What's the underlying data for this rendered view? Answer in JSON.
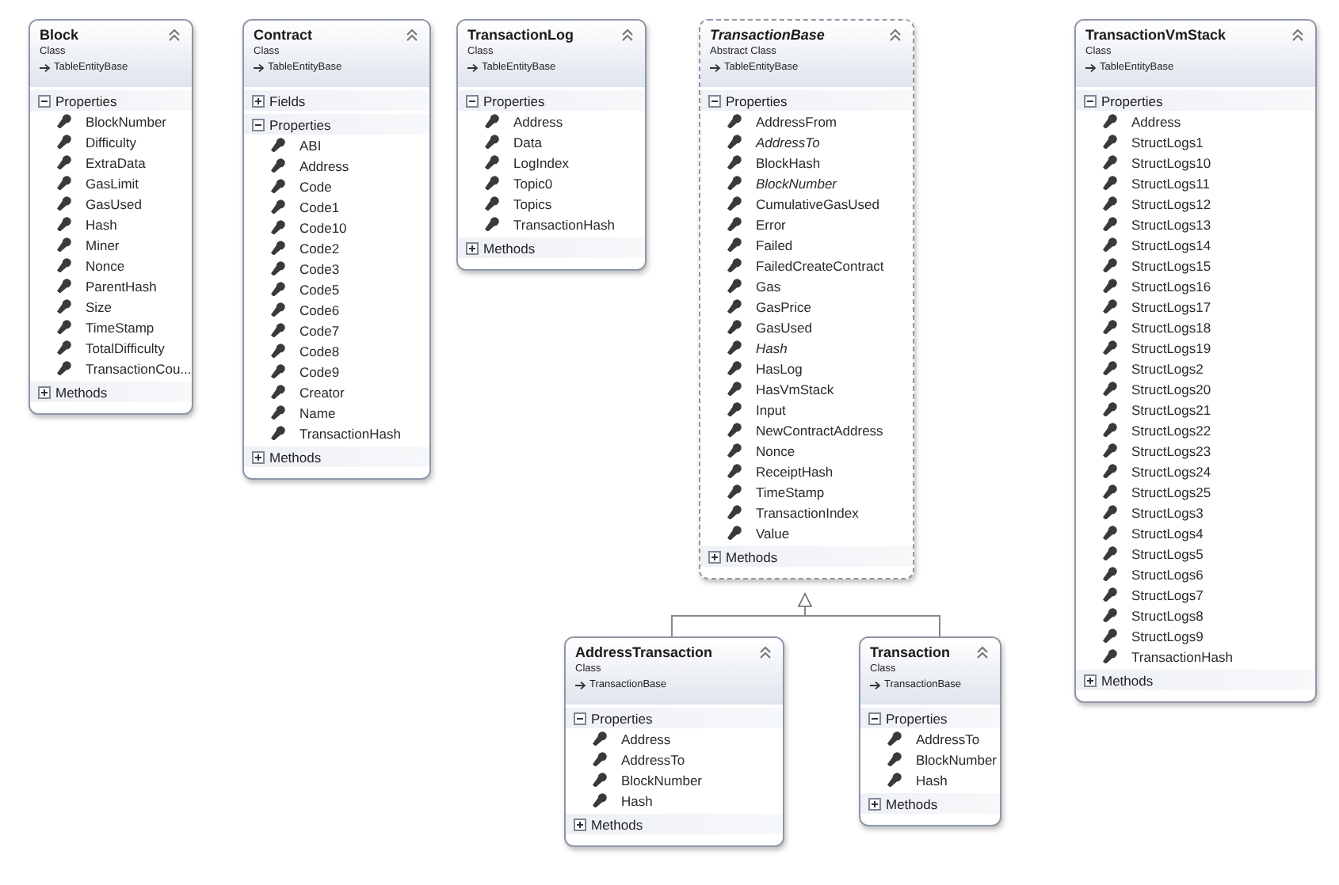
{
  "classes": [
    {
      "name": "Block",
      "kind": "Class",
      "base": "TableEntityBase",
      "abstract": false,
      "sections": [
        {
          "label": "Properties",
          "expanded": true,
          "members": [
            {
              "name": "BlockNumber",
              "italic": false
            },
            {
              "name": "Difficulty",
              "italic": false
            },
            {
              "name": "ExtraData",
              "italic": false
            },
            {
              "name": "GasLimit",
              "italic": false
            },
            {
              "name": "GasUsed",
              "italic": false
            },
            {
              "name": "Hash",
              "italic": false
            },
            {
              "name": "Miner",
              "italic": false
            },
            {
              "name": "Nonce",
              "italic": false
            },
            {
              "name": "ParentHash",
              "italic": false
            },
            {
              "name": "Size",
              "italic": false
            },
            {
              "name": "TimeStamp",
              "italic": false
            },
            {
              "name": "TotalDifficulty",
              "italic": false
            },
            {
              "name": "TransactionCou...",
              "italic": false
            }
          ]
        },
        {
          "label": "Methods",
          "expanded": false
        }
      ]
    },
    {
      "name": "Contract",
      "kind": "Class",
      "base": "TableEntityBase",
      "abstract": false,
      "sections": [
        {
          "label": "Fields",
          "expanded": false
        },
        {
          "label": "Properties",
          "expanded": true,
          "members": [
            {
              "name": "ABI",
              "italic": false
            },
            {
              "name": "Address",
              "italic": false
            },
            {
              "name": "Code",
              "italic": false
            },
            {
              "name": "Code1",
              "italic": false
            },
            {
              "name": "Code10",
              "italic": false
            },
            {
              "name": "Code2",
              "italic": false
            },
            {
              "name": "Code3",
              "italic": false
            },
            {
              "name": "Code5",
              "italic": false
            },
            {
              "name": "Code6",
              "italic": false
            },
            {
              "name": "Code7",
              "italic": false
            },
            {
              "name": "Code8",
              "italic": false
            },
            {
              "name": "Code9",
              "italic": false
            },
            {
              "name": "Creator",
              "italic": false
            },
            {
              "name": "Name",
              "italic": false
            },
            {
              "name": "TransactionHash",
              "italic": false
            }
          ]
        },
        {
          "label": "Methods",
          "expanded": false
        }
      ]
    },
    {
      "name": "TransactionLog",
      "kind": "Class",
      "base": "TableEntityBase",
      "abstract": false,
      "sections": [
        {
          "label": "Properties",
          "expanded": true,
          "members": [
            {
              "name": "Address",
              "italic": false
            },
            {
              "name": "Data",
              "italic": false
            },
            {
              "name": "LogIndex",
              "italic": false
            },
            {
              "name": "Topic0",
              "italic": false
            },
            {
              "name": "Topics",
              "italic": false
            },
            {
              "name": "TransactionHash",
              "italic": false
            }
          ]
        },
        {
          "label": "Methods",
          "expanded": false
        }
      ]
    },
    {
      "name": "TransactionBase",
      "kind": "Abstract Class",
      "base": "TableEntityBase",
      "abstract": true,
      "sections": [
        {
          "label": "Properties",
          "expanded": true,
          "members": [
            {
              "name": "AddressFrom",
              "italic": false
            },
            {
              "name": "AddressTo",
              "italic": true
            },
            {
              "name": "BlockHash",
              "italic": false
            },
            {
              "name": "BlockNumber",
              "italic": true
            },
            {
              "name": "CumulativeGasUsed",
              "italic": false
            },
            {
              "name": "Error",
              "italic": false
            },
            {
              "name": "Failed",
              "italic": false
            },
            {
              "name": "FailedCreateContract",
              "italic": false
            },
            {
              "name": "Gas",
              "italic": false
            },
            {
              "name": "GasPrice",
              "italic": false
            },
            {
              "name": "GasUsed",
              "italic": false
            },
            {
              "name": "Hash",
              "italic": true
            },
            {
              "name": "HasLog",
              "italic": false
            },
            {
              "name": "HasVmStack",
              "italic": false
            },
            {
              "name": "Input",
              "italic": false
            },
            {
              "name": "NewContractAddress",
              "italic": false
            },
            {
              "name": "Nonce",
              "italic": false
            },
            {
              "name": "ReceiptHash",
              "italic": false
            },
            {
              "name": "TimeStamp",
              "italic": false
            },
            {
              "name": "TransactionIndex",
              "italic": false
            },
            {
              "name": "Value",
              "italic": false
            }
          ]
        },
        {
          "label": "Methods",
          "expanded": false
        }
      ]
    },
    {
      "name": "TransactionVmStack",
      "kind": "Class",
      "base": "TableEntityBase",
      "abstract": false,
      "sections": [
        {
          "label": "Properties",
          "expanded": true,
          "members": [
            {
              "name": "Address",
              "italic": false
            },
            {
              "name": "StructLogs1",
              "italic": false
            },
            {
              "name": "StructLogs10",
              "italic": false
            },
            {
              "name": "StructLogs11",
              "italic": false
            },
            {
              "name": "StructLogs12",
              "italic": false
            },
            {
              "name": "StructLogs13",
              "italic": false
            },
            {
              "name": "StructLogs14",
              "italic": false
            },
            {
              "name": "StructLogs15",
              "italic": false
            },
            {
              "name": "StructLogs16",
              "italic": false
            },
            {
              "name": "StructLogs17",
              "italic": false
            },
            {
              "name": "StructLogs18",
              "italic": false
            },
            {
              "name": "StructLogs19",
              "italic": false
            },
            {
              "name": "StructLogs2",
              "italic": false
            },
            {
              "name": "StructLogs20",
              "italic": false
            },
            {
              "name": "StructLogs21",
              "italic": false
            },
            {
              "name": "StructLogs22",
              "italic": false
            },
            {
              "name": "StructLogs23",
              "italic": false
            },
            {
              "name": "StructLogs24",
              "italic": false
            },
            {
              "name": "StructLogs25",
              "italic": false
            },
            {
              "name": "StructLogs3",
              "italic": false
            },
            {
              "name": "StructLogs4",
              "italic": false
            },
            {
              "name": "StructLogs5",
              "italic": false
            },
            {
              "name": "StructLogs6",
              "italic": false
            },
            {
              "name": "StructLogs7",
              "italic": false
            },
            {
              "name": "StructLogs8",
              "italic": false
            },
            {
              "name": "StructLogs9",
              "italic": false
            },
            {
              "name": "TransactionHash",
              "italic": false
            }
          ]
        },
        {
          "label": "Methods",
          "expanded": false
        }
      ]
    },
    {
      "name": "AddressTransaction",
      "kind": "Class",
      "base": "TransactionBase",
      "abstract": false,
      "sections": [
        {
          "label": "Properties",
          "expanded": true,
          "members": [
            {
              "name": "Address",
              "italic": false
            },
            {
              "name": "AddressTo",
              "italic": false
            },
            {
              "name": "BlockNumber",
              "italic": false
            },
            {
              "name": "Hash",
              "italic": false
            }
          ]
        },
        {
          "label": "Methods",
          "expanded": false
        }
      ]
    },
    {
      "name": "Transaction",
      "kind": "Class",
      "base": "TransactionBase",
      "abstract": false,
      "sections": [
        {
          "label": "Properties",
          "expanded": true,
          "members": [
            {
              "name": "AddressTo",
              "italic": false
            },
            {
              "name": "BlockNumber",
              "italic": false
            },
            {
              "name": "Hash",
              "italic": false
            }
          ]
        },
        {
          "label": "Methods",
          "expanded": false
        }
      ]
    }
  ]
}
